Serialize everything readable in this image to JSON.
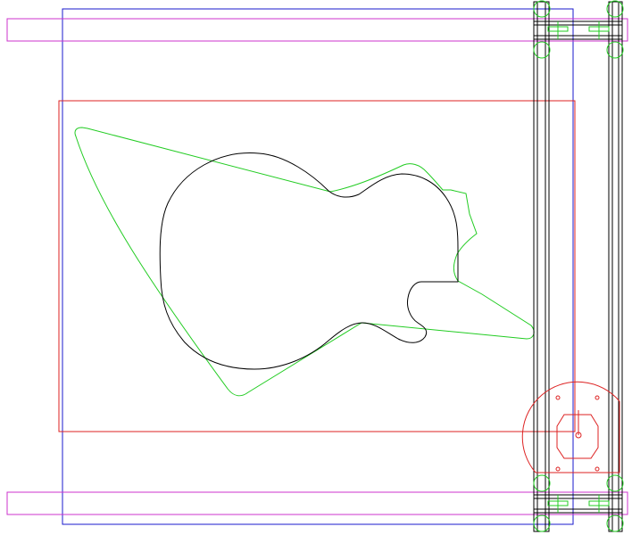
{
  "colors": {
    "background": "#ffffff",
    "table_frame": "#1a1acc",
    "work_area": "#dd2222",
    "rails": "#cc33cc",
    "template": "#22cc22",
    "body_outline": "#000000",
    "gantry": "#000000",
    "spindle": "#dd2222",
    "clamps": "#22cc22"
  },
  "layers": [
    "table-frame",
    "work-area",
    "top-rail",
    "bottom-rail",
    "guitar-template",
    "guitar-body-outline",
    "gantry",
    "spindle-mount",
    "clamps"
  ]
}
